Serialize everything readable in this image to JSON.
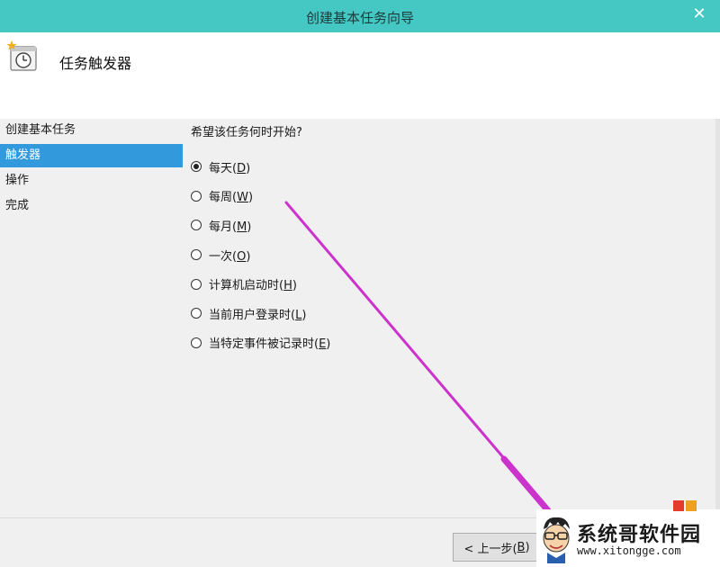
{
  "window": {
    "title": "创建基本任务向导",
    "close_glyph": "✕"
  },
  "header": {
    "title": "任务触发器"
  },
  "sidebar": {
    "items": [
      {
        "label": "创建基本任务",
        "active": false
      },
      {
        "label": "触发器",
        "active": true
      },
      {
        "label": "操作",
        "active": false
      },
      {
        "label": "完成",
        "active": false
      }
    ]
  },
  "main": {
    "question": "希望该任务何时开始?",
    "options": [
      {
        "label": "每天(",
        "key": "D",
        "end": ")",
        "checked": true
      },
      {
        "label": "每周(",
        "key": "W",
        "end": ")",
        "checked": false
      },
      {
        "label": "每月(",
        "key": "M",
        "end": ")",
        "checked": false
      },
      {
        "label": "一次(",
        "key": "O",
        "end": ")",
        "checked": false
      },
      {
        "label": "计算机启动时(",
        "key": "H",
        "end": ")",
        "checked": false
      },
      {
        "label": "当前用户登录时(",
        "key": "L",
        "end": ")",
        "checked": false
      },
      {
        "label": "当特定事件被记录时(",
        "key": "E",
        "end": ")",
        "checked": false
      }
    ]
  },
  "footer": {
    "back_label": "< 上一步(",
    "back_key": "B",
    "back_end": ")"
  },
  "watermark": {
    "title": "系统哥软件园",
    "url": "www.xitongge.com"
  },
  "colors": {
    "titlebar": "#45c8c4",
    "selection": "#3399dd",
    "arrow": "#cc33cc"
  }
}
